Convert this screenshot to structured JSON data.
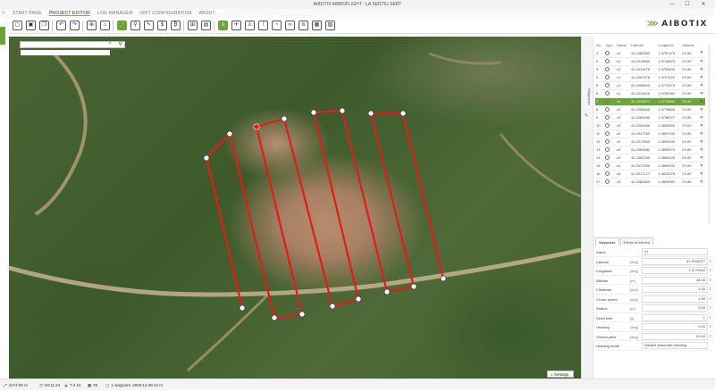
{
  "app": {
    "title": "AIBOTIX AIBROFLIGHT - LA SENTIU SERT",
    "window_controls": [
      "—",
      "☐",
      "✕"
    ]
  },
  "nav": {
    "back_icon": "‹",
    "items": [
      {
        "label": "START PAGE",
        "active": false
      },
      {
        "label": "PROJECT EDITOR",
        "active": true
      },
      {
        "label": "LOG MANAGER",
        "active": false
      },
      {
        "label": "UNIT CONFIGURATION",
        "active": false
      },
      {
        "label": "ABOUT",
        "active": false
      }
    ]
  },
  "logo": {
    "mark": "⋙",
    "text": "AIBOTIX"
  },
  "toolbar": {
    "buttons": [
      {
        "name": "new-file-icon",
        "glyph": "▢",
        "on": false
      },
      {
        "name": "save-icon",
        "glyph": "▣",
        "on": false
      },
      {
        "name": "copy-icon",
        "glyph": "❐",
        "on": false
      },
      {
        "name": "undo-icon",
        "glyph": "↶",
        "on": false
      },
      {
        "name": "redo-icon",
        "glyph": "↷",
        "on": false
      },
      {
        "name": "crosshair-icon",
        "glyph": "⊕",
        "on": false
      },
      {
        "name": "home-icon",
        "glyph": "⌂",
        "on": false
      },
      {
        "name": "waypoint-route-icon",
        "glyph": "⋰",
        "on": true
      },
      {
        "name": "marker-icon",
        "glyph": "⚲",
        "on": false
      },
      {
        "name": "brush-icon",
        "glyph": "✎",
        "on": false
      },
      {
        "name": "dollar-icon",
        "glyph": "$",
        "on": false
      },
      {
        "name": "coin-icon",
        "glyph": "₿",
        "on": false
      },
      {
        "name": "grid-icon",
        "glyph": "⊞",
        "on": false
      },
      {
        "name": "document-icon",
        "glyph": "▤",
        "on": false
      },
      {
        "name": "flight-plan-icon",
        "glyph": "≡",
        "on": true
      },
      {
        "name": "drone-icon",
        "glyph": "✈",
        "on": false
      },
      {
        "name": "person-icon",
        "glyph": "♙",
        "on": false
      },
      {
        "name": "antenna-icon",
        "glyph": "⊺",
        "on": false
      },
      {
        "name": "compass-icon",
        "glyph": "◔",
        "on": false
      },
      {
        "name": "link-icon",
        "glyph": "∞",
        "on": false
      },
      {
        "name": "wifi-icon",
        "glyph": "≋",
        "on": false
      },
      {
        "name": "table-icon",
        "glyph": "▦",
        "on": false
      },
      {
        "name": "image-icon",
        "glyph": "▨",
        "on": false
      }
    ]
  },
  "search": {
    "placeholder": "",
    "value": "",
    "clear_icon": "×",
    "search_icon": "⚲"
  },
  "side_tab": {
    "label": "Waypoints",
    "pin_icon": "✎"
  },
  "waypoints": {
    "headers": [
      "No.",
      "Type",
      "Name",
      "Latitude",
      "Longitude",
      "Altitude",
      ""
    ],
    "rows": [
      {
        "no": "1",
        "name": "x1",
        "lat": "41.2380183",
        "lon": "1.3751379",
        "alt": "23.00",
        "selected": false
      },
      {
        "no": "2",
        "name": "x1",
        "lat": "41.2010860",
        "lon": "1.3718823",
        "alt": "23.00",
        "selected": false
      },
      {
        "no": "3",
        "name": "x1",
        "lat": "41.2010478",
        "lon": "1.3750832",
        "alt": "23.00",
        "selected": false
      },
      {
        "no": "4",
        "name": "x1",
        "lat": "41.2067478",
        "lon": "1.3707522",
        "alt": "23.00",
        "selected": false
      },
      {
        "no": "5",
        "name": "x1",
        "lat": "41.2058404",
        "lon": "1.3773275",
        "alt": "23.00",
        "selected": false
      },
      {
        "no": "6",
        "name": "x1",
        "lat": "41.2014420",
        "lon": "1.3752082",
        "alt": "23.00",
        "selected": false
      },
      {
        "no": "7",
        "name": "x1",
        "lat": "41.2018377",
        "lon": "1.3770402",
        "alt": "23.00",
        "selected": true
      },
      {
        "no": "8",
        "name": "x2",
        "lat": "41.2058340",
        "lon": "1.3778800",
        "alt": "23.00",
        "selected": false
      },
      {
        "no": "9",
        "name": "x2",
        "lat": "41.2060430",
        "lon": "1.3758027",
        "alt": "23.00",
        "selected": false
      },
      {
        "no": "10",
        "name": "x2",
        "lat": "41.2090430",
        "lon": "1.3803000",
        "alt": "23.00",
        "selected": false
      },
      {
        "no": "11",
        "name": "x2",
        "lat": "41.2017760",
        "lon": "1.3807433",
        "alt": "23.00",
        "selected": false
      },
      {
        "no": "12",
        "name": "x2",
        "lat": "41.2017843",
        "lon": "1.3809030",
        "alt": "23.00",
        "selected": false
      },
      {
        "no": "13",
        "name": "x2",
        "lat": "41.2081882",
        "lon": "1.3809070",
        "alt": "23.00",
        "selected": false
      },
      {
        "no": "14",
        "name": "x2",
        "lat": "41.2062340",
        "lon": "1.3808100",
        "alt": "23.00",
        "selected": false
      },
      {
        "no": "15",
        "name": "x2",
        "lat": "41.2017300",
        "lon": "1.3808933",
        "alt": "23.00",
        "selected": false
      },
      {
        "no": "16",
        "name": "x3",
        "lat": "41.2017177",
        "lon": "1.3812078",
        "alt": "23.00",
        "selected": false
      },
      {
        "no": "17",
        "name": "x3",
        "lat": "41.2083303",
        "lon": "1.3809083",
        "alt": "23.00",
        "selected": false
      }
    ],
    "delete_icon": "✕"
  },
  "detail_tabs": [
    {
      "label": "Waypoints",
      "active": true
    },
    {
      "label": "Points of interest",
      "active": false
    }
  ],
  "properties": [
    {
      "label": "Name",
      "unit": "",
      "value": "x1",
      "align": "left",
      "spin": false
    },
    {
      "label": "Latitude",
      "unit": "[deg]",
      "value": "41.2018377",
      "align": "right",
      "spin": true
    },
    {
      "label": "Longitude",
      "unit": "[deg]",
      "value": "1.3770402",
      "align": "right",
      "spin": true
    },
    {
      "label": "Altitude",
      "unit": "[m]",
      "value": "44.00",
      "align": "right",
      "spin": true
    },
    {
      "label": "Climbrate",
      "unit": "[m/s]",
      "value": "1.00",
      "align": "right",
      "spin": true
    },
    {
      "label": "Cruise speed",
      "unit": "[m/s]",
      "value": "1.00",
      "align": "right",
      "spin": true
    },
    {
      "label": "Radius",
      "unit": "[m]",
      "value": "5.00",
      "align": "right",
      "spin": true
    },
    {
      "label": "Dwell time",
      "unit": "[s]",
      "value": "1",
      "align": "right",
      "spin": true
    },
    {
      "label": "Heading",
      "unit": "[deg]",
      "value": "0.00",
      "align": "right",
      "spin": true
    },
    {
      "label": "Gimbal pitch",
      "unit": "[deg]",
      "value": "90.00",
      "align": "right",
      "spin": true
    },
    {
      "label": "Heading mode",
      "unit": "",
      "value": "Disable automatic heading",
      "align": "left",
      "spin": false
    }
  ],
  "map": {
    "settings_label": "Settings",
    "settings_icon": "≡"
  },
  "status": {
    "items": [
      {
        "icon": "⤢",
        "text": "2474.00 m"
      },
      {
        "icon": "◷",
        "text": "00:11:24"
      },
      {
        "icon": "⟁",
        "text": "7.4 16"
      },
      {
        "icon": "▦",
        "text": "#0"
      },
      {
        "icon": "▢",
        "text": "1 waypoint, 2000:12:48:12 m"
      }
    ]
  },
  "flight_path": {
    "color": "#e31b1b",
    "points": [
      [
        231,
        177
      ],
      [
        257,
        150
      ],
      [
        307,
        356
      ],
      [
        338,
        352
      ],
      [
        287,
        142
      ],
      [
        318,
        133
      ],
      [
        372,
        343
      ],
      [
        401,
        335
      ],
      [
        351,
        126
      ],
      [
        383,
        124
      ],
      [
        433,
        327
      ],
      [
        463,
        321
      ],
      [
        415,
        127
      ],
      [
        451,
        127
      ],
      [
        496,
        312
      ],
      [
        271,
        345
      ]
    ]
  }
}
